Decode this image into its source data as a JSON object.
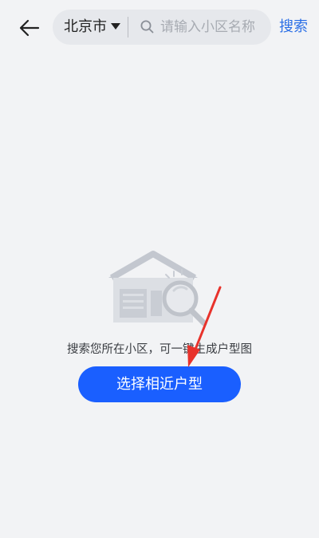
{
  "header": {
    "back_icon": "arrow-left-icon",
    "city": "北京市",
    "city_caret_icon": "caret-down-icon",
    "search_icon": "search-icon",
    "search_placeholder": "请输入小区名称",
    "search_value": "",
    "search_button_label": "搜索"
  },
  "empty_state": {
    "illustration_icon": "house-search-icon",
    "message": "搜索您所在小区，可一键生成户型图",
    "action_label": "选择相近户型"
  },
  "annotation": {
    "type": "red-arrow",
    "color": "#e8322b"
  },
  "colors": {
    "background": "#f2f3f5",
    "accent": "#1a5fff",
    "link": "#2b6fe6"
  }
}
